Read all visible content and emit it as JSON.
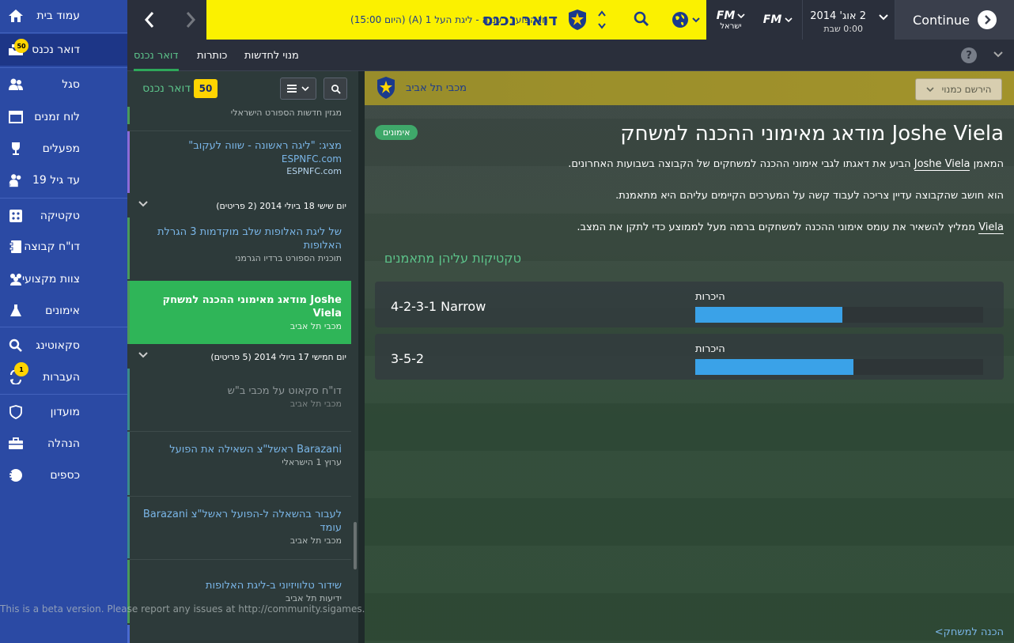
{
  "sidebar": {
    "items": [
      {
        "label": "עמוד בית",
        "icon": "home-icon"
      },
      {
        "label": "דואר נכנס",
        "icon": "inbox-icon",
        "badge": "50"
      },
      {
        "label": "סגל",
        "icon": "squad-icon"
      },
      {
        "label": "לוח זמנים",
        "icon": "calendar-icon"
      },
      {
        "label": "מפעלים",
        "icon": "trophy-icon"
      },
      {
        "label": "עד גיל 19",
        "icon": "u19-icon"
      },
      {
        "label": "טקטיקה",
        "icon": "tactics-icon"
      },
      {
        "label": "דו\"ח קבוצה",
        "icon": "team-report-icon"
      },
      {
        "label": "צוות מקצועי",
        "icon": "staff-icon"
      },
      {
        "label": "אימונים",
        "icon": "training-icon"
      },
      {
        "label": "סקאוטינג",
        "icon": "search-icon"
      },
      {
        "label": "העברות",
        "icon": "transfers-icon",
        "badge": "1"
      },
      {
        "label": "מועדון",
        "icon": "club-icon"
      },
      {
        "label": "הנהלה",
        "icon": "board-icon"
      },
      {
        "label": "כספים",
        "icon": "finances-icon"
      }
    ]
  },
  "topbar": {
    "title": "דואר נכנס",
    "fixture": "(היום 15:00) (A) הפועל רעננה - ליגת העל 1 in",
    "fm_label": "FM",
    "fm_sub": "ישראל",
    "fm_logo": "FM",
    "date_line1": "2 אוג' 2014",
    "date_line2": "0:00 שבת",
    "continue_label": "Continue"
  },
  "tabs": {
    "inbox": "דואר נכנס",
    "headlines": "כותרות",
    "news_sub": "מנוי לחדשות"
  },
  "list": {
    "title": "דואר נכנס",
    "badge": "50",
    "messages": [
      {
        "subtitle": "מגזין חדשות הספורט הישראלי"
      },
      {
        "title": "מציג: \"ליגה ראשונה - שווה לעקוב\"",
        "link": "ESPNFC.com",
        "subtitle": "ESPNFC.com"
      },
      {
        "title": "של ליגת האלופות שלב מוקדמות 3 הגרלת האלופות",
        "subtitle": "תוכנית הספורט ברדיו הגרמני"
      },
      {
        "title": "Joshe מודאג מאימוני ההכנה למשחק Viela",
        "subtitle": "מכבי תל אביב"
      },
      {
        "title": "דו\"ח סקאוט על מכבי ב\"ש",
        "subtitle": "מכבי תל אביב"
      },
      {
        "title": "Barazani ראשל\"צ השאילה את הפועל",
        "subtitle": "ערוץ 1 הישראלי"
      },
      {
        "title": "לעבור בהשאלה ל-הפועל ראשל\"צ Barazani עומד",
        "subtitle": "מכבי תל אביב"
      },
      {
        "title": "שידור טלוויזיוני ב-ליגת האלופות",
        "subtitle": "ידיעות תל אביב"
      }
    ],
    "date_headers": [
      "יום שישי 18 ביולי 2014 (2 פריטים)",
      "יום חמישי 17 ביולי 2014 (5 פריטים)"
    ],
    "beta_notice": "This is a beta version. Please report any issues at http://community.sigames.com/"
  },
  "message": {
    "club": "מכבי תל אביב",
    "sign_label": "הירשם כמנוי",
    "headline": "Joshe Viela מודאג מאימוני ההכנה למשחק",
    "tag": "אימונים",
    "para1_pre": "המאמן ",
    "para1_name": "Joshe Viela",
    "para1_post": " הביע את דאגתו לגבי אימוני ההכנה למשחקים של הקבוצה בשבועות האחרונים.",
    "para2": "הוא חושב שהקבוצה עדיין צריכה לעבוד קשה על המערכים הקיימים עליהם היא מתאמנת.",
    "para3_name": "Viela",
    "para3_post": " ממליץ להשאיר את עומס אימוני ההכנה למשחקים ברמה מעל לממוצע כדי לתקן את המצב.",
    "section_title": "טקטיקות עליהן מתאמנים",
    "tactics": [
      {
        "name": "4-2-3-1 Narrow",
        "label": "היכרות",
        "familiarity": 0.51
      },
      {
        "name": "3-5-2",
        "label": "היכרות",
        "familiarity": 0.55
      }
    ],
    "bottom_link": "הכנה למשחק>"
  },
  "colors": {
    "sidebar": "#2b4aa4",
    "accent_yellow": "#fbf100",
    "accent_green": "#2fb558",
    "bar_blue": "#3aa2e8"
  }
}
